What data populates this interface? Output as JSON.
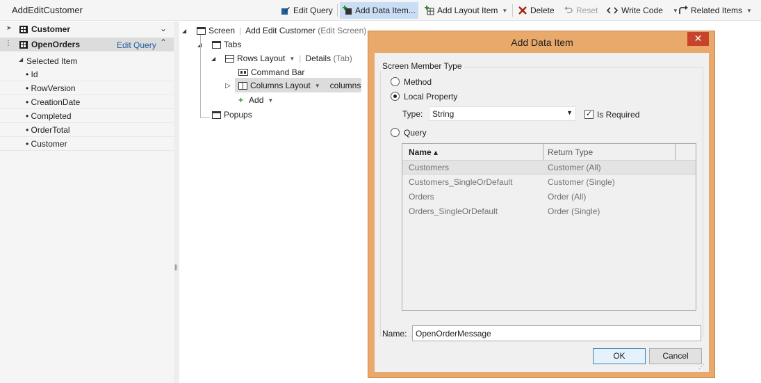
{
  "app": {
    "title": "AddEditCustomer"
  },
  "toolbar": {
    "edit_query": "Edit Query",
    "add_data_item": "Add Data Item...",
    "add_layout_item": "Add Layout Item",
    "delete": "Delete",
    "reset": "Reset",
    "write_code": "Write Code",
    "related_items": "Related Items"
  },
  "left": {
    "customer_label": "Customer",
    "openorders_label": "OpenOrders",
    "edit_query_link": "Edit Query",
    "selected_item": "Selected Item",
    "fields": [
      "Id",
      "RowVersion",
      "CreationDate",
      "Completed",
      "OrderTotal",
      "Customer"
    ]
  },
  "tree": {
    "screen": "Screen",
    "screen_name": "Add Edit Customer",
    "screen_kind": "(Edit Screen)",
    "tabs": "Tabs",
    "rows_layout": "Rows Layout",
    "details": "Details",
    "details_kind": "(Tab)",
    "command_bar": "Command Bar",
    "columns_layout": "Columns Layout",
    "columns_value": "columns",
    "add": "Add",
    "popups": "Popups"
  },
  "dialog": {
    "title": "Add Data Item",
    "close": "✕",
    "group_label": "Screen Member Type",
    "method": "Method",
    "local_property": "Local Property",
    "type_label": "Type:",
    "type_value": "String",
    "is_required": "Is Required",
    "query": "Query",
    "columns": {
      "name": "Name ▴",
      "return_type": "Return Type"
    },
    "queries": [
      {
        "name": "Customers",
        "type": "Customer (All)"
      },
      {
        "name": "Customers_SingleOrDefault",
        "type": "Customer (Single)"
      },
      {
        "name": "Orders",
        "type": "Order (All)"
      },
      {
        "name": "Orders_SingleOrDefault",
        "type": "Order (Single)"
      }
    ],
    "name_label": "Name:",
    "name_value": "OpenOrderMessage",
    "ok": "OK",
    "cancel": "Cancel"
  }
}
